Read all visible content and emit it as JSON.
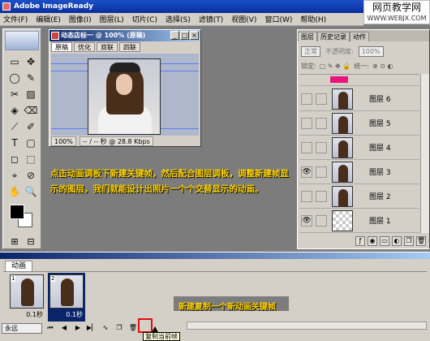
{
  "window": {
    "title": "Adobe ImageReady"
  },
  "watermark": {
    "line1": "网页教学网",
    "line2": "WWW.WEBJX.COM"
  },
  "menu": [
    "文件(F)",
    "编辑(E)",
    "图像(I)",
    "图层(L)",
    "切片(C)",
    "选择(S)",
    "滤镜(T)",
    "视图(V)",
    "窗口(W)",
    "帮助(H)"
  ],
  "toolbox": {
    "tools": [
      "▭",
      "✥",
      "◯",
      "✎",
      "✂",
      "▨",
      "◈",
      "⌫",
      "⟋",
      "✐",
      "T",
      "▢",
      "◻",
      "⬚",
      "⌖",
      "⊘",
      "✋",
      "🔍"
    ],
    "bottom": [
      "⊞",
      "⊟"
    ]
  },
  "document": {
    "title": "动态店标一 @ 100% (原稿)",
    "tabs": [
      "原稿",
      "优化",
      "双联",
      "四联"
    ],
    "status": [
      "100%",
      "-- / -- 秒 @ 28.8 Kbps"
    ]
  },
  "layers": {
    "tabs": [
      "图层",
      "历史记录",
      "动作"
    ],
    "blend_mode": "正常",
    "opacity_label": "不透明度:",
    "opacity_value": "100%",
    "lock_label": "锁定:",
    "unify_label": "统一:",
    "items": [
      {
        "name": "图层 6",
        "visible": false
      },
      {
        "name": "图层 5",
        "visible": false
      },
      {
        "name": "图层 4",
        "visible": false
      },
      {
        "name": "图层 3",
        "visible": true
      },
      {
        "name": "图层 2",
        "visible": false
      },
      {
        "name": "图层 1",
        "visible": true
      }
    ]
  },
  "instruction": "点击动画调板下新建关键帧，然后配合图层调板，调整新建帧显示的图层，我们就能设计出照片一个个交替显示的动画。",
  "animation": {
    "tab": "动画",
    "frames": [
      {
        "number": "1",
        "delay": "0.1秒"
      },
      {
        "number": "2",
        "delay": "0.1秒"
      }
    ],
    "loop": "永远",
    "annotation": "新建复制一个新动画关键帧",
    "tooltip": "复制当前帧"
  }
}
